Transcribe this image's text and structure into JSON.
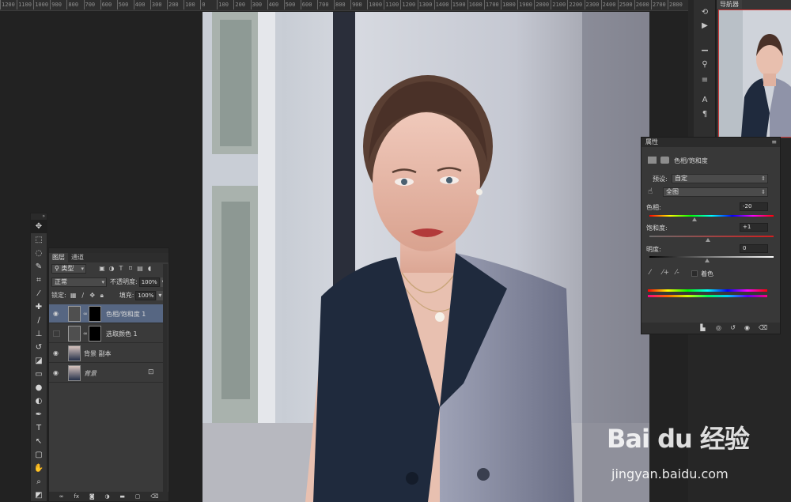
{
  "ruler": {
    "ticks": [
      "1200",
      "1100",
      "1000",
      "900",
      "800",
      "700",
      "600",
      "500",
      "400",
      "300",
      "200",
      "100",
      "0",
      "100",
      "200",
      "300",
      "400",
      "500",
      "600",
      "700",
      "800",
      "900",
      "1000",
      "1100",
      "1200",
      "1300",
      "1400",
      "1500",
      "1600",
      "1700",
      "1800",
      "1900",
      "2000",
      "2100",
      "2200",
      "2300",
      "2400",
      "2500",
      "2600",
      "2700",
      "2800"
    ]
  },
  "navigator": {
    "tab_label": "导航器"
  },
  "layers_panel": {
    "tabs": [
      "图层",
      "通道"
    ],
    "filter_label": "类型",
    "blend_mode": "正常",
    "opacity_label": "不透明度:",
    "opacity_value": "100%",
    "lock_label": "锁定:",
    "fill_label": "填充:",
    "fill_value": "100%",
    "layers": [
      {
        "name": "色相/饱和度 1",
        "selected": true,
        "visible": true
      },
      {
        "name": "选取颜色 1",
        "selected": false,
        "visible": false
      },
      {
        "name": "背景 副本",
        "selected": false,
        "visible": true
      },
      {
        "name": "背景",
        "selected": false,
        "visible": true
      }
    ]
  },
  "properties_panel": {
    "title": "属性",
    "adjustment_name": "色相/饱和度",
    "preset_label": "预设:",
    "preset_value": "自定",
    "channel_value": "全图",
    "hue_label": "色相:",
    "hue_value": "-20",
    "saturation_label": "饱和度:",
    "saturation_value": "+1",
    "lightness_label": "明度:",
    "lightness_value": "0",
    "colorize_label": "着色"
  },
  "watermark": {
    "logo_text": "Bai du 经验",
    "url": "jingyan.baidu.com"
  },
  "colors": {
    "accent_selected_layer": "#566682",
    "panel_bg": "#3a3a3a",
    "app_bg": "#222222"
  }
}
